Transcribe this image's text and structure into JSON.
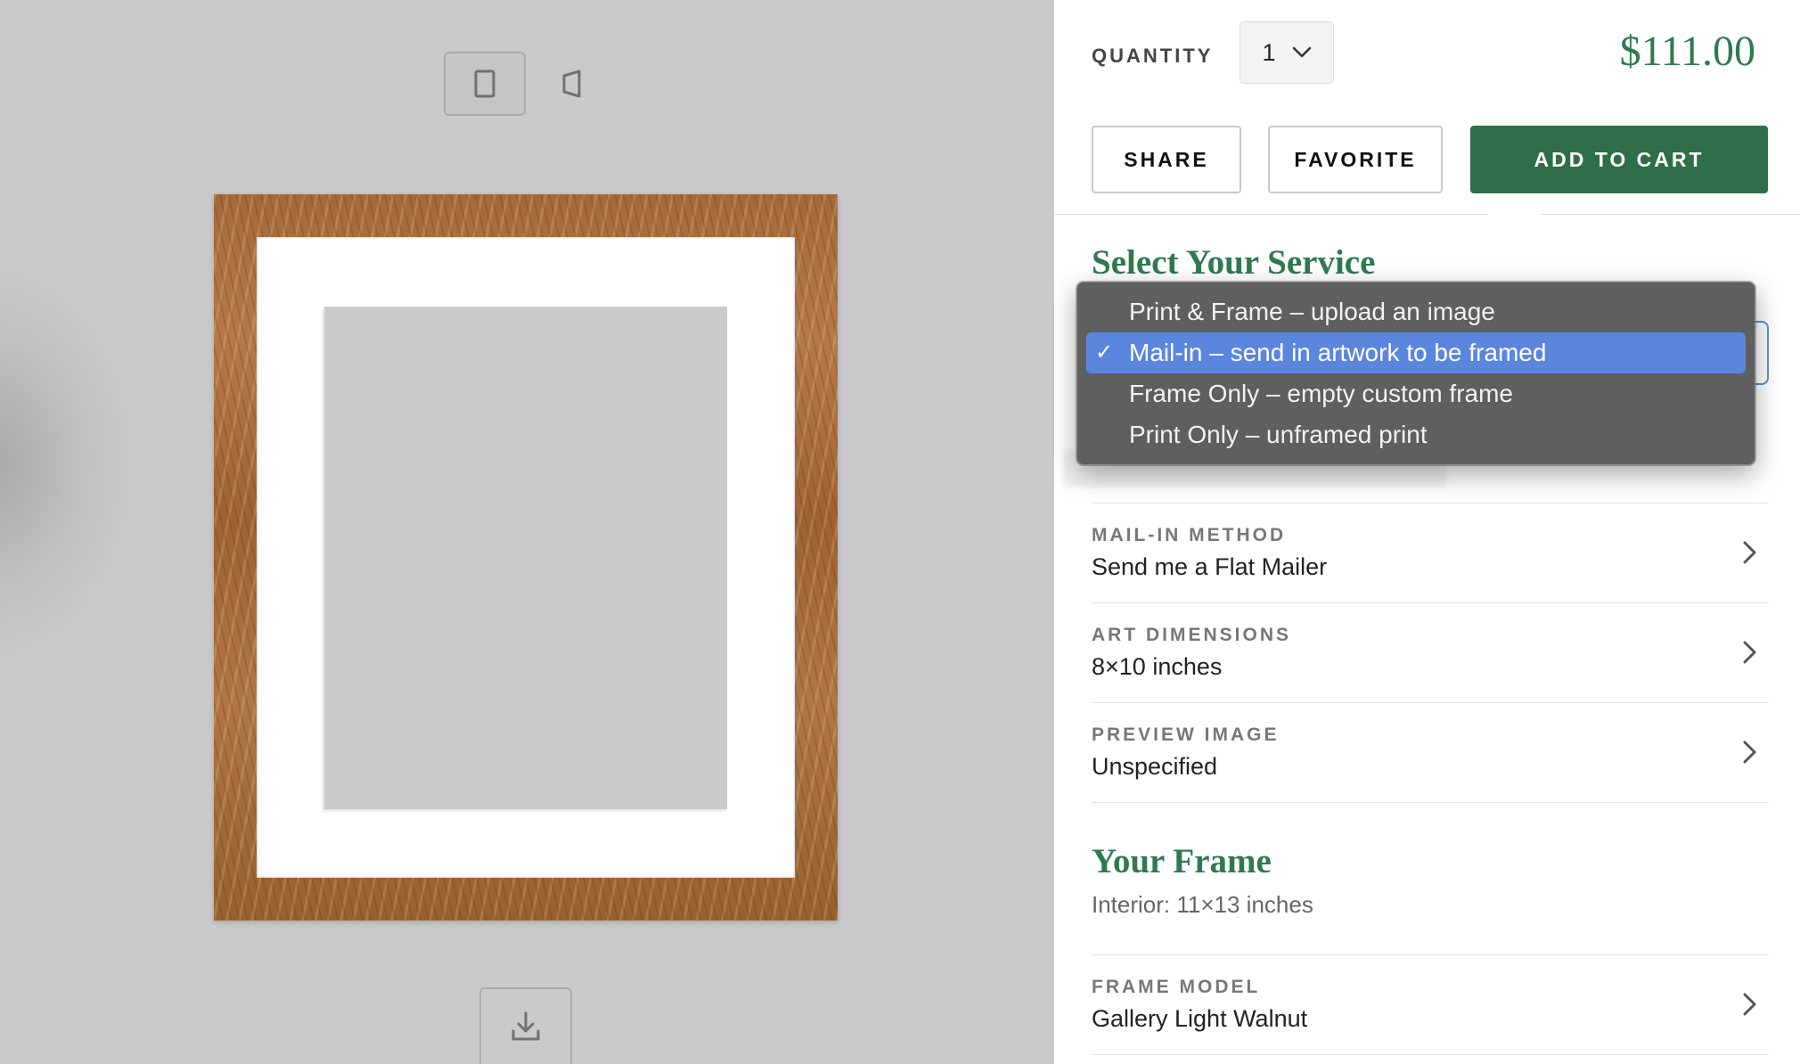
{
  "preview": {
    "orientation_toggle": {
      "portrait_icon": "portrait-orientation-icon",
      "landscape_icon": "landscape-orientation-icon",
      "active": "portrait"
    },
    "download_icon": "download-icon"
  },
  "header": {
    "quantity_label": "QUANTITY",
    "quantity_value": "1",
    "price": "$111.00",
    "share_label": "SHARE",
    "favorite_label": "FAVORITE",
    "add_to_cart_label": "ADD TO CART",
    "accent_color": "#2f7a4f",
    "cart_button_color": "#2e6e48"
  },
  "service": {
    "title": "Select Your Service",
    "options": [
      {
        "label": "Print & Frame – upload an image",
        "selected": false
      },
      {
        "label": "Mail-in – send in artwork to be framed",
        "selected": true
      },
      {
        "label": "Frame Only – empty custom frame",
        "selected": false
      },
      {
        "label": "Print Only – unframed print",
        "selected": false
      }
    ],
    "check_glyph": "✓",
    "highlight_color": "#5b86dd"
  },
  "options": [
    {
      "label": "MAIL-IN METHOD",
      "value": "Send me a Flat Mailer"
    },
    {
      "label": "ART DIMENSIONS",
      "value": "8×10 inches"
    },
    {
      "label": "PREVIEW IMAGE",
      "value": "Unspecified"
    }
  ],
  "frame": {
    "title": "Your Frame",
    "interior": "Interior: 11×13 inches",
    "model_label": "FRAME MODEL",
    "model_value": "Gallery Light Walnut"
  }
}
